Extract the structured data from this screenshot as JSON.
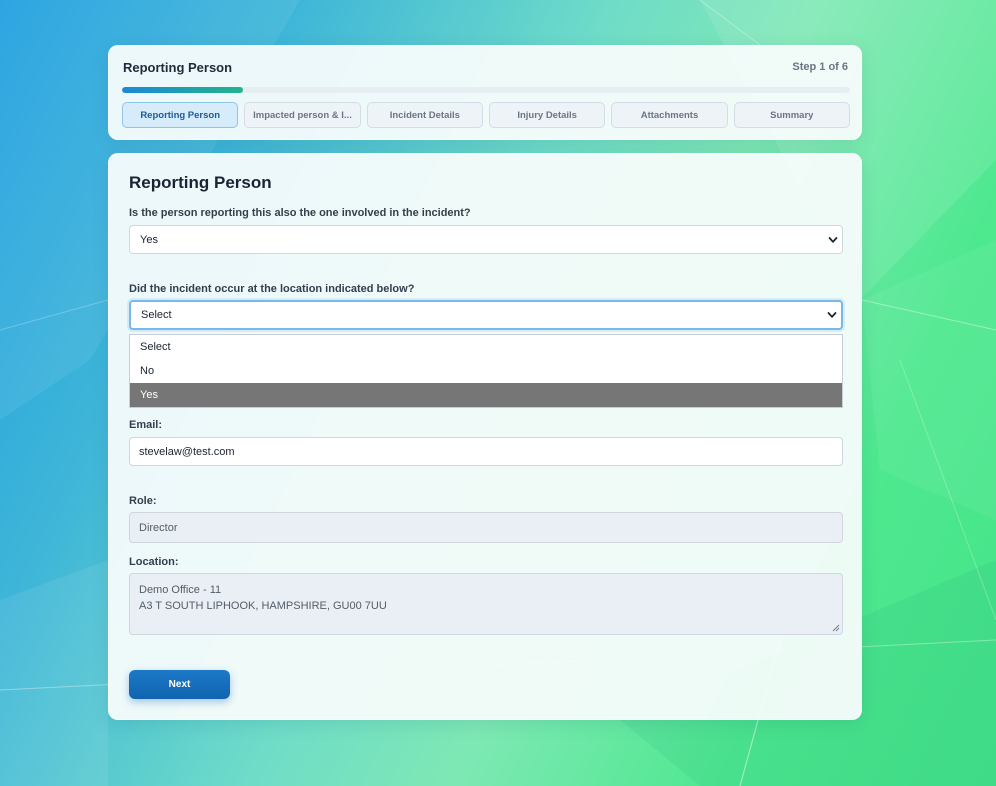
{
  "colors": {
    "accent": "#1a6bbf",
    "progress_start": "#1a88d6",
    "progress_end": "#22b58a",
    "highlight_option": "#767676"
  },
  "stepper": {
    "title": "Reporting Person",
    "step_text": "Step 1 of 6",
    "progress_fraction": 0.1667,
    "tabs": [
      {
        "label": "Reporting Person",
        "active": true
      },
      {
        "label": "Impacted person & I...",
        "active": false
      },
      {
        "label": "Incident Details",
        "active": false
      },
      {
        "label": "Injury Details",
        "active": false
      },
      {
        "label": "Attachments",
        "active": false
      },
      {
        "label": "Summary",
        "active": false
      }
    ]
  },
  "form": {
    "title": "Reporting Person",
    "q1": {
      "label": "Is the person reporting this also the one involved in the incident?",
      "value": "Yes"
    },
    "q2": {
      "label": "Did the incident occur at the location indicated below?",
      "value": "Select",
      "options": [
        "Select",
        "No",
        "Yes"
      ],
      "highlighted_option": "Yes"
    },
    "email": {
      "label": "Email:",
      "value": "stevelaw@test.com"
    },
    "role": {
      "label": "Role:",
      "value": "Director"
    },
    "location": {
      "label": "Location:",
      "line1": "Demo Office - 11",
      "line2": "A3 T SOUTH LIPHOOK, HAMPSHIRE, GU00 7UU"
    },
    "next_label": "Next"
  }
}
